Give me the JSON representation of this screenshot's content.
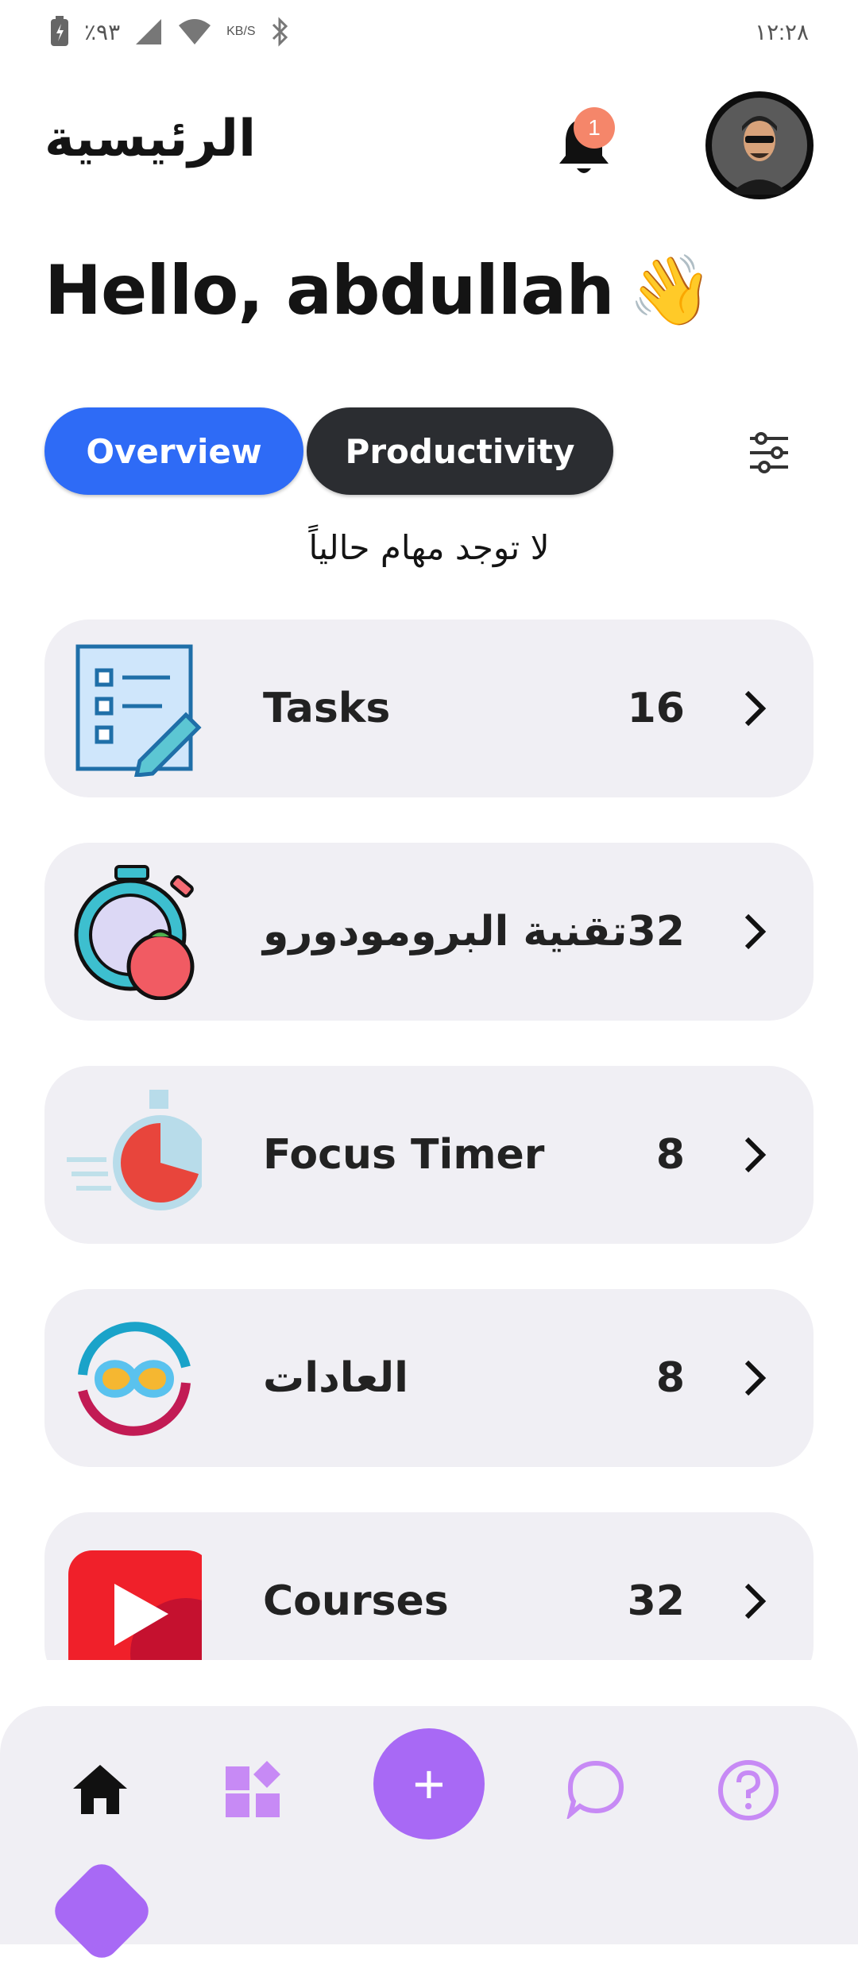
{
  "status_bar": {
    "time": "١٢:٢٨",
    "battery": "٪٩٣",
    "net_speed_unit": "KB/S"
  },
  "header": {
    "title": "الرئيسية",
    "notification_count": "1"
  },
  "greeting": {
    "text": "Hello, abdullah",
    "emoji": "👋"
  },
  "tabs": [
    {
      "label": "Overview"
    },
    {
      "label": "Productivity"
    }
  ],
  "empty_message": "لا توجد مهام حالياً",
  "cards": [
    {
      "label": "Tasks",
      "count": "16",
      "icon": "task-list-icon"
    },
    {
      "label": "تقنية البرومودورو",
      "count": "32",
      "icon": "stopwatch-tomato-icon"
    },
    {
      "label": "Focus Timer",
      "count": "8",
      "icon": "focus-timer-icon"
    },
    {
      "label": "العادات",
      "count": "8",
      "icon": "habits-infinity-icon"
    },
    {
      "label": "Courses",
      "count": "32",
      "icon": "play-video-icon"
    }
  ],
  "colors": {
    "tab_active": "#2e6bf6",
    "tab_inactive": "#2b2d31",
    "card_bg": "#f0eff4",
    "accent_purple": "#a869f5",
    "badge": "#f5866a"
  }
}
